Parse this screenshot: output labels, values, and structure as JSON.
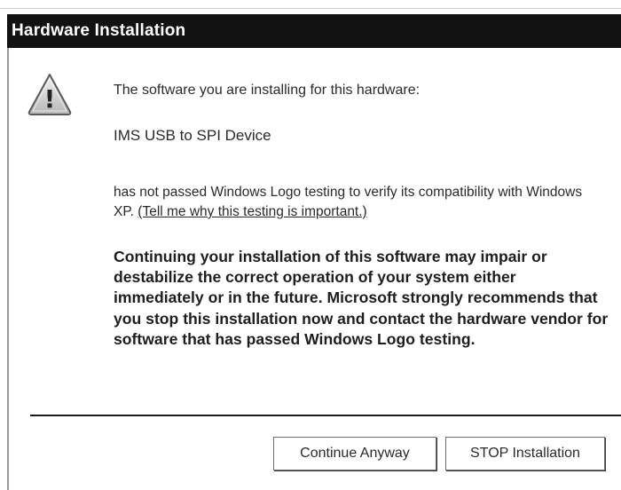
{
  "window": {
    "title": "Hardware Installation"
  },
  "icon": {
    "name": "warning-icon",
    "glyph": "!"
  },
  "message": {
    "intro": "The software you are installing for this hardware:",
    "device_name": "IMS USB to SPI Device",
    "logo_text_before_link": "has not passed Windows Logo testing to verify its compatibility with Windows XP. ",
    "link_text": "(Tell me why this testing is important.)",
    "warning": "Continuing your installation of this software may impair or destabilize the correct operation of your system either immediately or in the future. Microsoft strongly recommends that you stop this installation now and contact the hardware vendor for software that has passed Windows Logo testing."
  },
  "buttons": {
    "continue_label": "Continue Anyway",
    "stop_label": "STOP Installation"
  }
}
